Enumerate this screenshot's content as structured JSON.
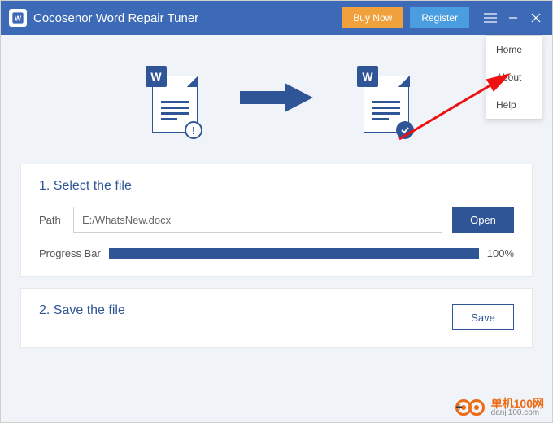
{
  "titlebar": {
    "app_name": "Cocosenor Word Repair Tuner",
    "buy_label": "Buy Now",
    "register_label": "Register"
  },
  "menu": {
    "items": [
      "Home",
      "About",
      "Help"
    ]
  },
  "hero": {
    "badge_letter": "W",
    "err_symbol": "!",
    "ok_symbol": "✓"
  },
  "select_card": {
    "heading": "1. Select the file",
    "path_label": "Path",
    "path_value": "E:/WhatsNew.docx",
    "open_label": "Open",
    "progress_label": "Progress Bar",
    "progress_pct": "100%"
  },
  "save_card": {
    "heading": "2. Save the file",
    "save_label": "Save"
  },
  "watermark": {
    "line1": "单机100网",
    "line2": "danji100.com"
  }
}
